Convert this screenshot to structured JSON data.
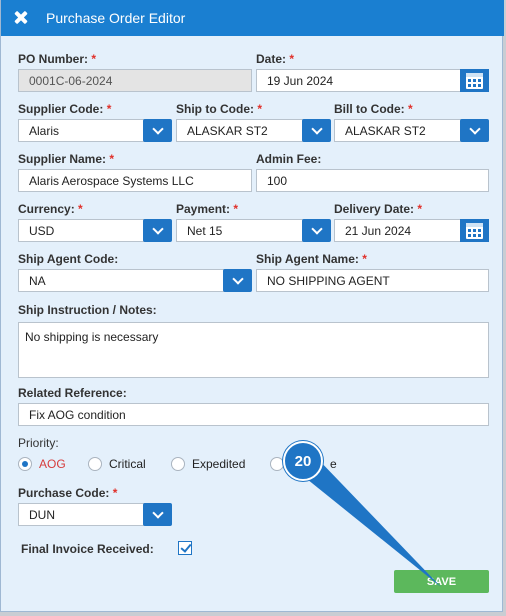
{
  "dialog": {
    "title": "Purchase Order Editor"
  },
  "form": {
    "po_number": {
      "label": "PO Number:",
      "required": "*",
      "value": "0001C-06-2024"
    },
    "date": {
      "label": "Date:",
      "required": "*",
      "value": "19 Jun 2024"
    },
    "supplier_code": {
      "label": "Supplier Code:",
      "required": "*",
      "value": "Alaris"
    },
    "ship_to_code": {
      "label": "Ship to Code:",
      "required": "*",
      "value": "ALASKAR ST2"
    },
    "bill_to_code": {
      "label": "Bill to Code:",
      "required": "*",
      "value": "ALASKAR ST2"
    },
    "supplier_name": {
      "label": "Supplier Name:",
      "required": "*",
      "value": "Alaris Aerospace Systems LLC"
    },
    "admin_fee": {
      "label": "Admin Fee:",
      "value": "100"
    },
    "currency": {
      "label": "Currency:",
      "required": "*",
      "value": "USD"
    },
    "payment": {
      "label": "Payment:",
      "required": "*",
      "value": "Net 15"
    },
    "delivery_date": {
      "label": "Delivery Date:",
      "required": "*",
      "value": "21 Jun 2024"
    },
    "ship_agent_code": {
      "label": "Ship Agent Code:",
      "value": "NA"
    },
    "ship_agent_name": {
      "label": "Ship Agent Name:",
      "required": "*",
      "value": "NO SHIPPING AGENT"
    },
    "ship_instruction": {
      "label": "Ship Instruction / Notes:",
      "value": "No shipping is necessary"
    },
    "related_reference": {
      "label": "Related Reference:",
      "value": "Fix AOG condition"
    },
    "priority": {
      "label": "Priority:",
      "options": [
        "AOG",
        "Critical",
        "Expedited",
        "Routine"
      ],
      "options_visible": [
        "AOG",
        "Critical",
        "Expedited",
        "e"
      ],
      "selected": "AOG"
    },
    "purchase_code": {
      "label": "Purchase Code:",
      "required": "*",
      "value": "DUN"
    },
    "final_invoice": {
      "label": "Final Invoice Received:",
      "checked": true
    }
  },
  "buttons": {
    "save": "SAVE"
  },
  "annotation": {
    "step": "20"
  },
  "colors": {
    "titlebar": "#1a7fd1",
    "background": "#e4f0fb",
    "accent": "#1f75c5",
    "required": "#e0302a",
    "save": "#5cb85c"
  },
  "icons": {
    "close": "close-icon",
    "calendar": "calendar-icon",
    "dropdown": "chevron-down-icon",
    "checkbox": "checkmark-icon"
  }
}
